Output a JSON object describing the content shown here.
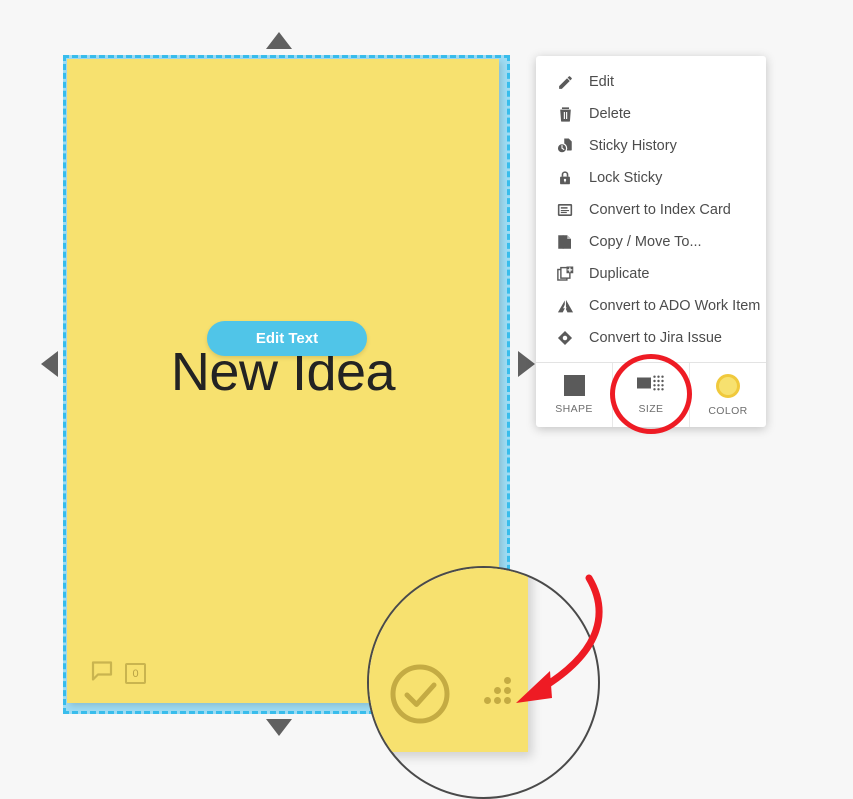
{
  "canvas": {
    "background_color": "#f7f7f7"
  },
  "sticky_note": {
    "text": "New Idea",
    "color": "#f7e16f",
    "selected": true,
    "selection_color": "#39bdec",
    "edit_text_button": {
      "label": "Edit Text",
      "color": "#50c5e8"
    },
    "footer": {
      "comment_icon": "comment-bubble-icon",
      "vote_count": "0"
    },
    "resize_handles": {
      "up": "triangle-up-icon",
      "down": "triangle-down-icon",
      "left": "triangle-left-icon",
      "right": "triangle-right-icon"
    }
  },
  "context_menu": {
    "items": [
      {
        "label": "Edit",
        "icon": "pencil-icon"
      },
      {
        "label": "Delete",
        "icon": "trash-icon"
      },
      {
        "label": "Sticky History",
        "icon": "history-clock-icon"
      },
      {
        "label": "Lock Sticky",
        "icon": "lock-icon"
      },
      {
        "label": "Convert to Index Card",
        "icon": "index-card-icon"
      },
      {
        "label": "Copy / Move To...",
        "icon": "copy-document-icon"
      },
      {
        "label": "Duplicate",
        "icon": "duplicate-plus-icon"
      },
      {
        "label": "Convert to ADO Work Item",
        "icon": "azure-devops-icon"
      },
      {
        "label": "Convert to Jira Issue",
        "icon": "jira-diamond-icon"
      }
    ],
    "footer_buttons": [
      {
        "label": "SHAPE",
        "icon": "square-shape-icon",
        "color": "#5a5a5a"
      },
      {
        "label": "SIZE",
        "icon": "size-grid-icon",
        "highlighted": true
      },
      {
        "label": "COLOR",
        "icon": "color-circle-icon",
        "color": "#f7e16f"
      }
    ]
  },
  "annotations": {
    "highlight_circle": {
      "target": "SIZE",
      "color": "#ee1b24"
    },
    "arrow": {
      "target": "resize-grip",
      "color": "#ee1b24"
    },
    "magnifier": {
      "shows": "sticky-note-bottom-right-corner",
      "check_icon": "check-circle-icon",
      "grip_icon": "resize-grip-dots-icon"
    }
  }
}
